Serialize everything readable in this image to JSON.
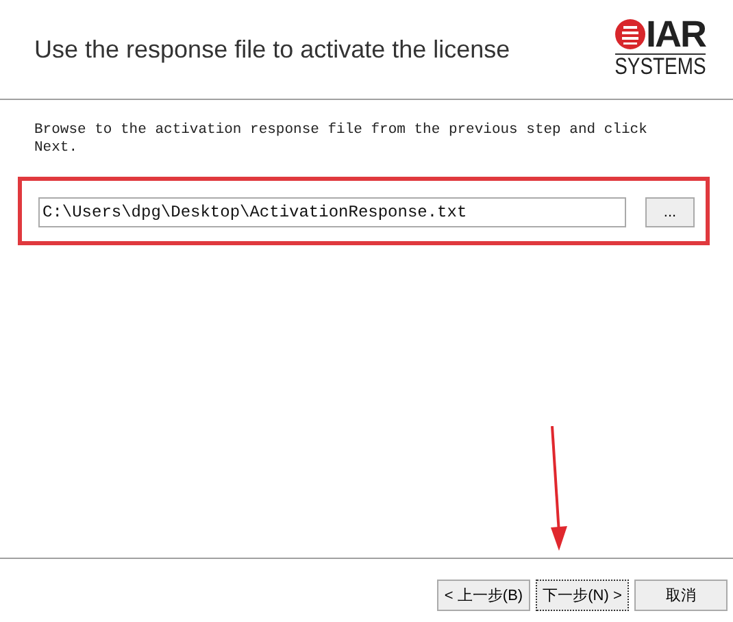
{
  "header": {
    "title": "Use the response file to activate the license",
    "logo": {
      "brand": "IAR",
      "sub": "SYSTEMS"
    }
  },
  "instruction": "Browse to the activation response file from the previous step and click Next.",
  "file_field": {
    "value": "C:\\Users\\dpg\\Desktop\\ActivationResponse.txt",
    "highlighted": true
  },
  "browse_button": {
    "label": "..."
  },
  "buttons": [
    {
      "label": "< 上一步(B)",
      "kind": "back"
    },
    {
      "label": "下一步(N) >",
      "kind": "next"
    },
    {
      "label": "取消",
      "kind": "cancel"
    }
  ]
}
